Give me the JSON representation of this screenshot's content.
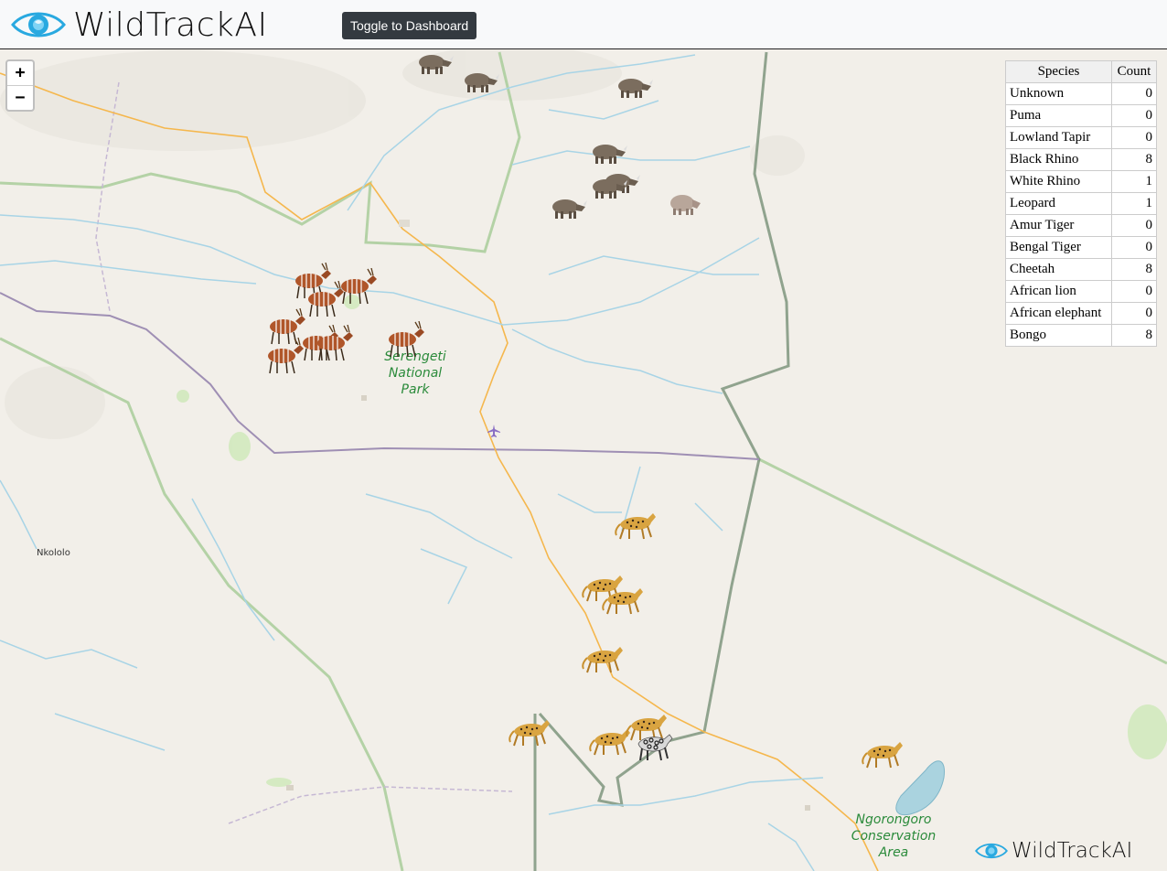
{
  "header": {
    "logo_text": "WildTrackAI",
    "toggle_label": "Toggle to Dashboard"
  },
  "map": {
    "zoom_in_label": "+",
    "zoom_out_label": "−",
    "park_label_serengeti": "Serengeti National Park",
    "park_label_ngorongoro": "Ngorongoro Conservation Area",
    "place_label_nkololo": "Nkololo",
    "watermark_text": "WildTrackAI"
  },
  "species_table": {
    "headers": [
      "Species",
      "Count"
    ],
    "rows": [
      {
        "species": "Unknown",
        "count": "0"
      },
      {
        "species": "Puma",
        "count": "0"
      },
      {
        "species": "Lowland Tapir",
        "count": "0"
      },
      {
        "species": "Black Rhino",
        "count": "8"
      },
      {
        "species": "White Rhino",
        "count": "1"
      },
      {
        "species": "Leopard",
        "count": "1"
      },
      {
        "species": "Amur Tiger",
        "count": "0"
      },
      {
        "species": "Bengal Tiger",
        "count": "0"
      },
      {
        "species": "Cheetah",
        "count": "8"
      },
      {
        "species": "African lion",
        "count": "0"
      },
      {
        "species": "African elephant",
        "count": "0"
      },
      {
        "species": "Bongo",
        "count": "8"
      }
    ]
  },
  "colors": {
    "map_background": "#f2efe9",
    "river": "#a8d4e6",
    "road": "#f5b74d",
    "protected_area_border": "#a9cc9a",
    "admin_border": "#9f8fb4",
    "button_bg": "#343a40",
    "park_label": "#2a8a3a"
  },
  "icons": {
    "logo": "eye-icon",
    "black_rhino": "black-rhino-icon",
    "white_rhino": "white-rhino-icon",
    "bongo": "bongo-icon",
    "cheetah": "cheetah-icon",
    "leopard": "leopard-icon",
    "airport": "airport-icon"
  }
}
